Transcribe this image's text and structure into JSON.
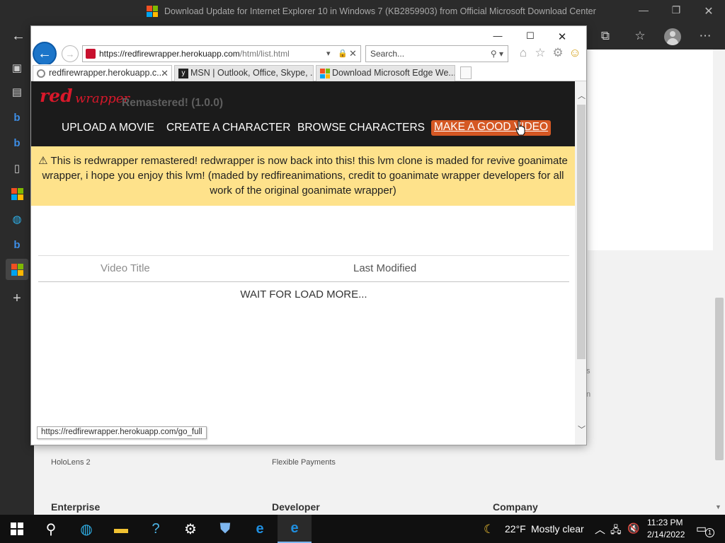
{
  "edge": {
    "title": "Download Update for Internet Explorer 10 in Windows 7 (KB2859903) from Official Microsoft Download Center",
    "bg_links": [
      "HoloLens 2",
      "Flexible Payments"
    ],
    "bg_headings": [
      "Enterprise",
      "Developer",
      "Company"
    ],
    "bg_fragments": [
      "s",
      "n"
    ]
  },
  "ie": {
    "url_host": "https://redfirewrapper.herokuapp.com",
    "url_path": "/html/list.html",
    "search_placeholder": "Search...",
    "tabs": [
      {
        "label": "redfirewrapper.herokuapp.c..."
      },
      {
        "label": "MSN | Outlook, Office, Skype, ..."
      },
      {
        "label": "Download Microsoft Edge We..."
      }
    ],
    "status_url": "https://redfirewrapper.herokuapp.com/go_full"
  },
  "site": {
    "logo_text": "red",
    "logo_sub": "wrapper",
    "version": "Remastered! (1.0.0)",
    "nav": [
      {
        "label": "UPLOAD A MOVIE"
      },
      {
        "label": "CREATE A CHARACTER"
      },
      {
        "label": "BROWSE CHARACTERS"
      },
      {
        "label": "MAKE A GOOD VIDEO"
      }
    ],
    "notice": "This is redwrapper remastered! redwrapper is now back into this! this lvm clone is maded for revive goanimate wrapper, i hope you enjoy this lvm! (maded by redfireanimations, credit to goanimate wrapper developers for all work of the original goanimate wrapper)",
    "table": {
      "col_title": "Video Title",
      "col_modified": "Last Modified",
      "loading_text": "WAIT FOR LOAD MORE..."
    }
  },
  "taskbar": {
    "weather_temp": "22°F",
    "weather_desc": "Mostly clear",
    "time": "11:23 PM",
    "date": "2/14/2022",
    "notification_count": "1"
  },
  "colors": {
    "accent_orange": "#d55824",
    "notice_yellow": "#fee28b",
    "logo_red": "#d8182a",
    "header_dark": "#1b1b1b"
  }
}
